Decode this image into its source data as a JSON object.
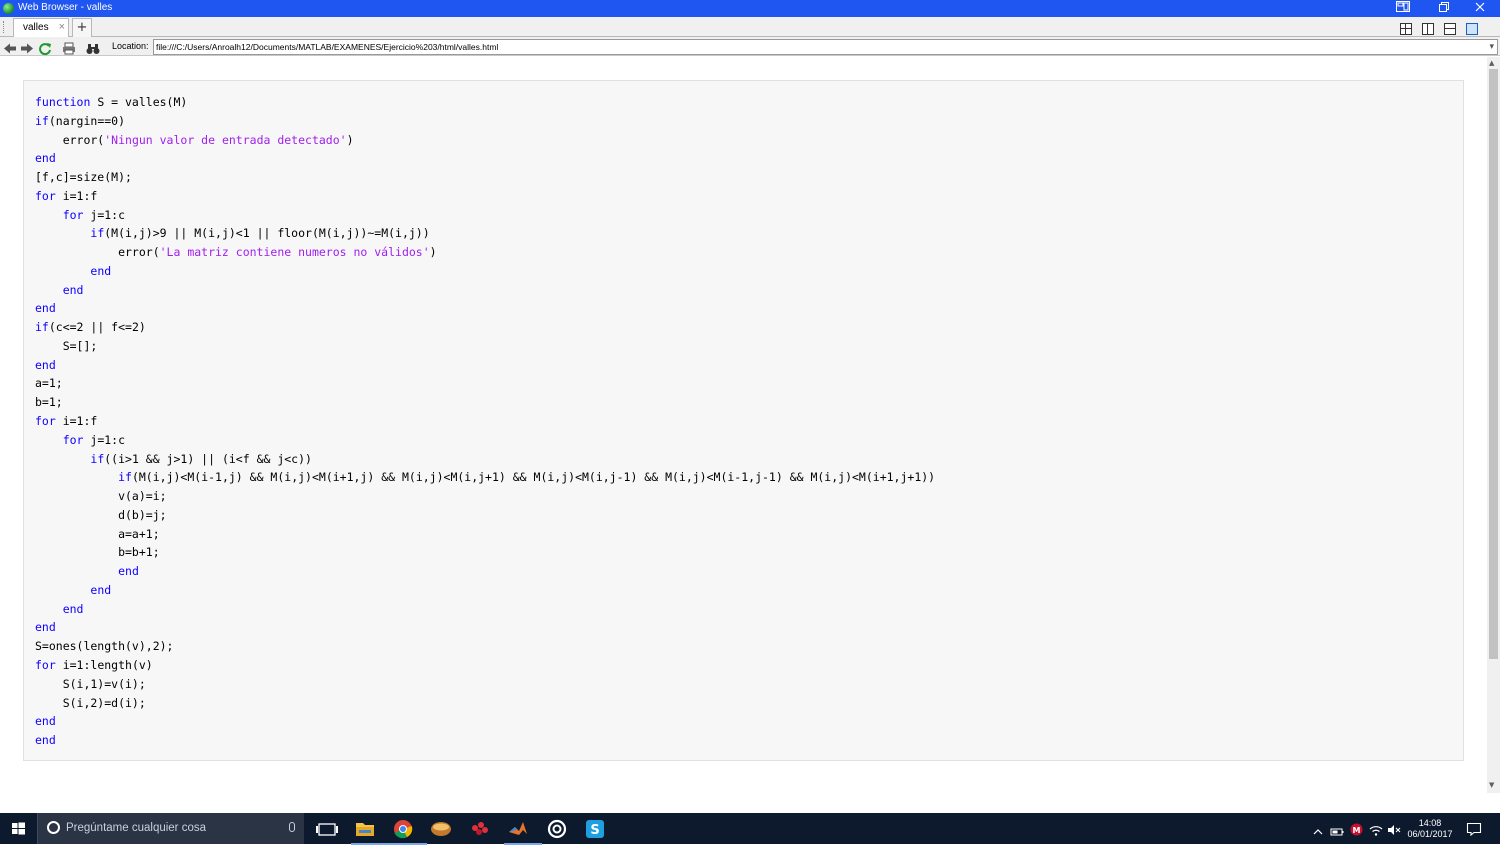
{
  "window": {
    "title": "Web Browser - valles"
  },
  "tabs": [
    {
      "label": "valles",
      "close": "×"
    }
  ],
  "new_tab": "+",
  "toolbar": {
    "location_label": "Location:",
    "location_value": "file:///C:/Users/Anroalh12/Documents/MATLAB/EXAMENES/Ejercicio%203/html/valles.html"
  },
  "code": {
    "lines": [
      [
        [
          "k",
          "function"
        ],
        [
          "t",
          " S = valles(M)"
        ]
      ],
      [
        [
          "k",
          "if"
        ],
        [
          "t",
          "(nargin==0)"
        ]
      ],
      [
        [
          "t",
          "    error("
        ],
        [
          "s",
          "'Ningun valor de entrada detectado'"
        ],
        [
          "t",
          ")"
        ]
      ],
      [
        [
          "k",
          "end"
        ]
      ],
      [
        [
          "t",
          "[f,c]=size(M);"
        ]
      ],
      [
        [
          "k",
          "for"
        ],
        [
          "t",
          " i=1:f"
        ]
      ],
      [
        [
          "t",
          "    "
        ],
        [
          "k",
          "for"
        ],
        [
          "t",
          " j=1:c"
        ]
      ],
      [
        [
          "t",
          "        "
        ],
        [
          "k",
          "if"
        ],
        [
          "t",
          "(M(i,j)>9 || M(i,j)<1 || floor(M(i,j))~=M(i,j))"
        ]
      ],
      [
        [
          "t",
          "            error("
        ],
        [
          "s",
          "'La matriz contiene numeros no válidos'"
        ],
        [
          "t",
          ")"
        ]
      ],
      [
        [
          "t",
          "        "
        ],
        [
          "k",
          "end"
        ]
      ],
      [
        [
          "t",
          "    "
        ],
        [
          "k",
          "end"
        ]
      ],
      [
        [
          "k",
          "end"
        ]
      ],
      [
        [
          "k",
          "if"
        ],
        [
          "t",
          "(c<=2 || f<=2)"
        ]
      ],
      [
        [
          "t",
          "    S=[];"
        ]
      ],
      [
        [
          "k",
          "end"
        ]
      ],
      [
        [
          "t",
          "a=1;"
        ]
      ],
      [
        [
          "t",
          "b=1;"
        ]
      ],
      [
        [
          "k",
          "for"
        ],
        [
          "t",
          " i=1:f"
        ]
      ],
      [
        [
          "t",
          "    "
        ],
        [
          "k",
          "for"
        ],
        [
          "t",
          " j=1:c"
        ]
      ],
      [
        [
          "t",
          "        "
        ],
        [
          "k",
          "if"
        ],
        [
          "t",
          "((i>1 && j>1) || (i<f && j<c))"
        ]
      ],
      [
        [
          "t",
          "            "
        ],
        [
          "k",
          "if"
        ],
        [
          "t",
          "(M(i,j)<M(i-1,j) && M(i,j)<M(i+1,j) && M(i,j)<M(i,j+1) && M(i,j)<M(i,j-1) && M(i,j)<M(i-1,j-1) && M(i,j)<M(i+1,j+1))"
        ]
      ],
      [
        [
          "t",
          "            v(a)=i;"
        ]
      ],
      [
        [
          "t",
          "            d(b)=j;"
        ]
      ],
      [
        [
          "t",
          "            a=a+1;"
        ]
      ],
      [
        [
          "t",
          "            b=b+1;"
        ]
      ],
      [
        [
          "t",
          "            "
        ],
        [
          "k",
          "end"
        ]
      ],
      [
        [
          "t",
          "        "
        ],
        [
          "k",
          "end"
        ]
      ],
      [
        [
          "t",
          "    "
        ],
        [
          "k",
          "end"
        ]
      ],
      [
        [
          "k",
          "end"
        ]
      ],
      [
        [
          "t",
          "S=ones(length(v),2);"
        ]
      ],
      [
        [
          "k",
          "for"
        ],
        [
          "t",
          " i=1:length(v)"
        ]
      ],
      [
        [
          "t",
          "    S(i,1)=v(i);"
        ]
      ],
      [
        [
          "t",
          "    S(i,2)=d(i);"
        ]
      ],
      [
        [
          "k",
          "end"
        ]
      ],
      [
        [
          "k",
          "end"
        ]
      ]
    ]
  },
  "taskbar": {
    "search_placeholder": "Pregúntame cualquier cosa",
    "time": "14:08",
    "date": "06/01/2017"
  },
  "colors": {
    "titlebar": "#1f55f0",
    "keyword": "#0e00ff",
    "string": "#a020f0",
    "taskbar": "#0d1a2e"
  }
}
